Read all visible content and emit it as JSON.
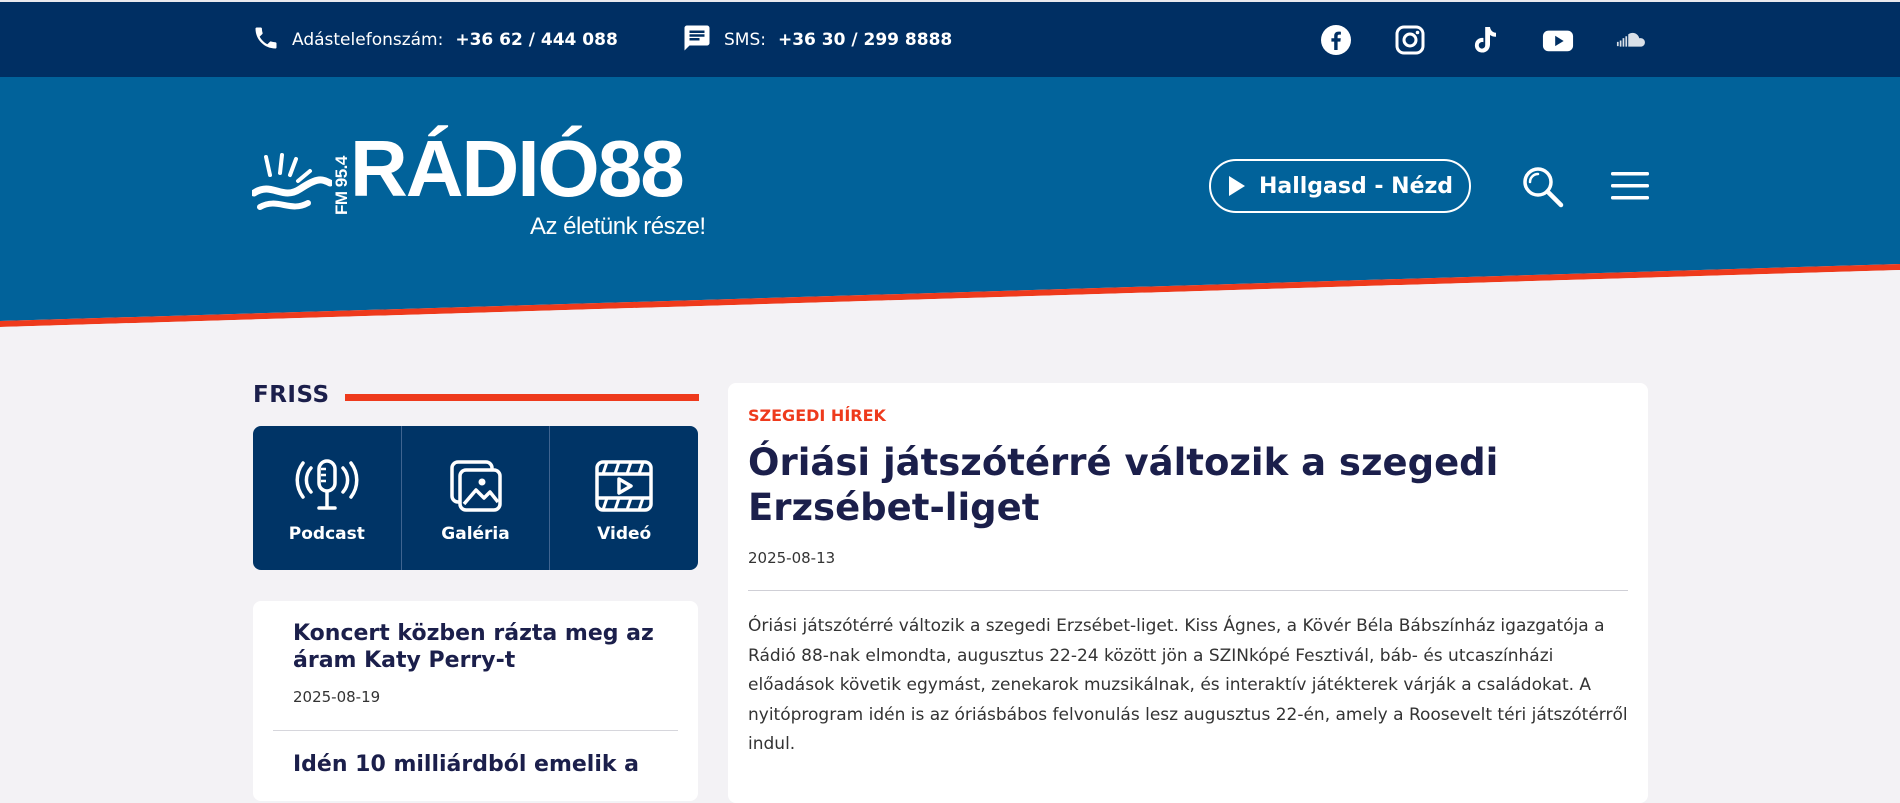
{
  "topbar": {
    "phone_label": "Adástelefonszám:",
    "phone_number": "+36 62 / 444 088",
    "sms_label": "SMS:",
    "sms_number": "+36 30 / 299 8888",
    "socials": [
      "facebook-icon",
      "instagram-icon",
      "tiktok-icon",
      "youtube-icon",
      "soundcloud-icon"
    ],
    "background": "#002f63"
  },
  "header": {
    "logo_fm": "FM 95.4",
    "logo_brand": "RÁDIÓ88",
    "logo_slogan": "Az életünk része!",
    "listen_label": "Hallgasd - Nézd",
    "background": "#01629a",
    "accent": "#ee3a1c"
  },
  "sidebar": {
    "title": "FRISS",
    "media": [
      {
        "label": "Podcast",
        "icon": "microphone-icon"
      },
      {
        "label": "Galéria",
        "icon": "gallery-icon"
      },
      {
        "label": "Videó",
        "icon": "video-icon"
      }
    ],
    "news": [
      {
        "title": "Koncert közben rázta meg az áram Katy Perry-t",
        "date": "2025-08-19"
      },
      {
        "title": "Idén 10 milliárdból emelik a"
      }
    ]
  },
  "article": {
    "category": "SZEGEDI HÍREK",
    "title": "Óriási játszótérré változik a szegedi Erzsébet-liget",
    "date": "2025-08-13",
    "body": "Óriási játszótérré változik a szegedi Erzsébet-liget. Kiss Ágnes, a Kövér Béla Bábszínház igazgatója a Rádió 88-nak elmondta, augusztus 22-24 között jön a SZINkópé Fesztivál, báb- és utcaszínházi előadások követik egymást, zenekarok muzsikálnak, és interaktív játékterek várják a családokat. A nyitóprogram idén is az óriásbábos felvonulás lesz augusztus 22-én, amely a Roosevelt téri játszótérről indul."
  }
}
